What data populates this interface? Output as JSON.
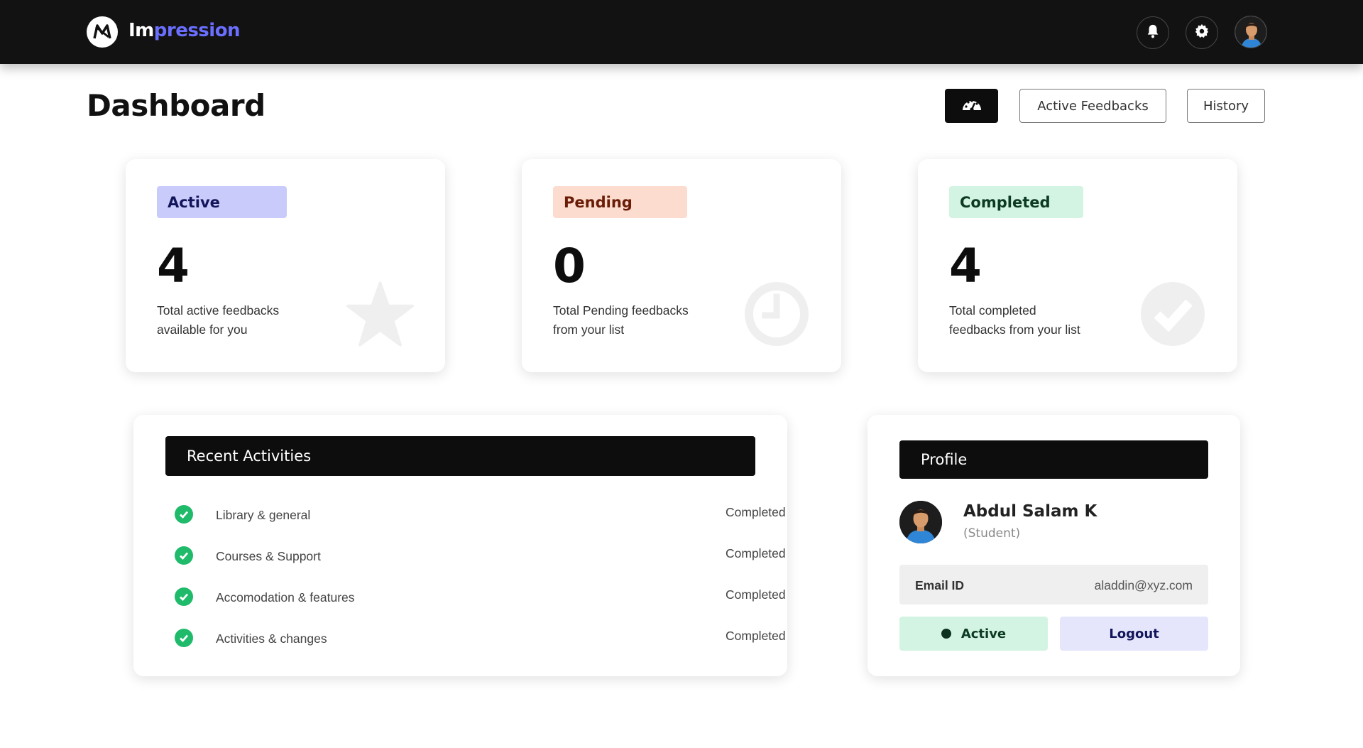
{
  "brand": {
    "part1": "Im",
    "part2": "pression"
  },
  "topbar": {
    "icons": [
      "bell-icon",
      "gear-icon",
      "user-avatar"
    ]
  },
  "header": {
    "title": "Dashboard",
    "dashboard_icon": "speedometer-icon",
    "active_feedbacks_label": "Active Feedbacks",
    "history_label": "History"
  },
  "stats": [
    {
      "badge": "Active",
      "count": "4",
      "desc_line1": "Total active feedbacks",
      "desc_line2": "available for you",
      "icon": "star-icon",
      "badge_bg": "#c9ccfb",
      "badge_fg": "#12155a"
    },
    {
      "badge": "Pending",
      "count": "0",
      "desc_line1": "Total Pending feedbacks",
      "desc_line2": "from your list",
      "icon": "clock-icon",
      "badge_bg": "#fbdccf",
      "badge_fg": "#6b1c06"
    },
    {
      "badge": "Completed",
      "count": "4",
      "desc_line1": "Total completed",
      "desc_line2": "feedbacks from your list",
      "icon": "check-circle-icon",
      "badge_bg": "#d3f4e2",
      "badge_fg": "#0c3a22"
    }
  ],
  "recent": {
    "title": "Recent Activities",
    "items": [
      {
        "label": "Library & general",
        "status": "Completed"
      },
      {
        "label": "Courses & Support",
        "status": "Completed"
      },
      {
        "label": "Accomodation & features",
        "status": "Completed"
      },
      {
        "label": "Activities & changes",
        "status": "Completed"
      }
    ]
  },
  "profile": {
    "title": "Profile",
    "name": "Abdul Salam K",
    "role": "(Student)",
    "email_label": "Email ID",
    "email_value": "aladdin@xyz.com",
    "status_label": "Active",
    "logout_label": "Logout"
  },
  "colors": {
    "accent": "#6b6fff",
    "check": "#1fba6a",
    "active_btn_bg": "#d3f4e2",
    "logout_btn_bg": "#e5e6fc"
  }
}
